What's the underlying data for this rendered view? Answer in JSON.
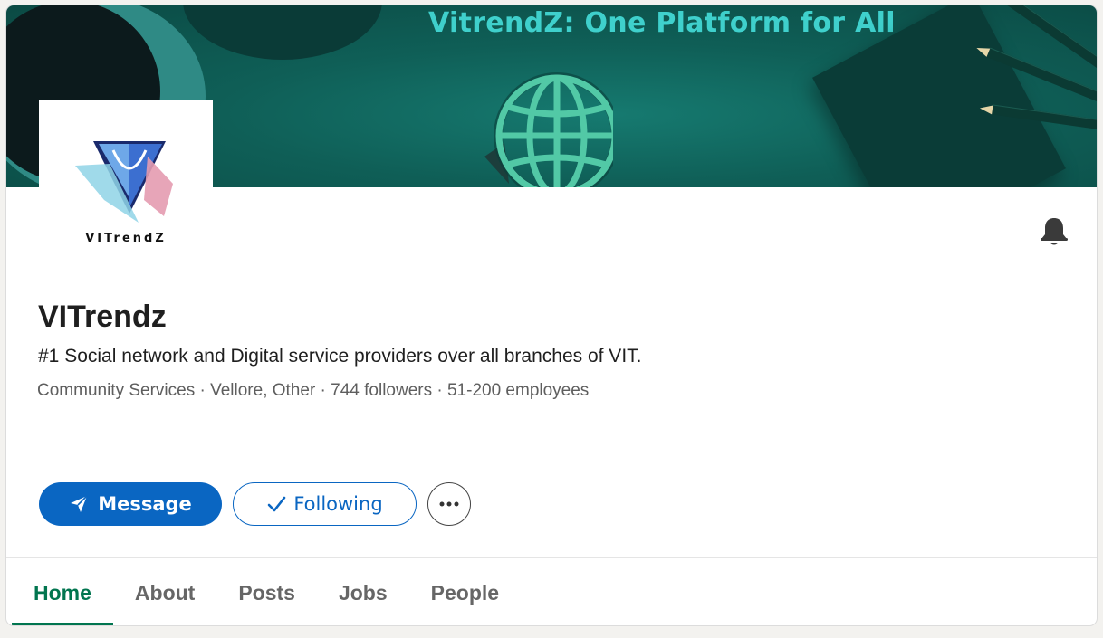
{
  "banner": {
    "title": "VitrendZ: One Platform for All",
    "accent_color": "#3fd0cc"
  },
  "logo": {
    "wordmark": "VITrendZ"
  },
  "company": {
    "name": "VITrendz",
    "tagline": "#1 Social network and Digital service providers over all branches of VIT.",
    "meta": "Community Services · Vellore, Other · 744 followers · 51-200 employees"
  },
  "actions": {
    "message_label": "Message",
    "following_label": "Following",
    "more_icon": "ellipsis-icon",
    "bell_icon": "bell-icon"
  },
  "tabs": [
    {
      "label": "Home",
      "active": true
    },
    {
      "label": "About",
      "active": false
    },
    {
      "label": "Posts",
      "active": false
    },
    {
      "label": "Jobs",
      "active": false
    },
    {
      "label": "People",
      "active": false
    }
  ],
  "colors": {
    "primary_blue": "#0a66c2",
    "active_tab_green": "#01754f"
  }
}
